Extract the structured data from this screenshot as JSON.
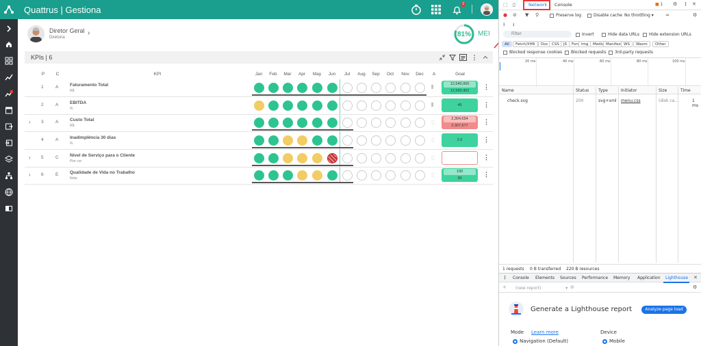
{
  "app": {
    "brand": "Quattrus | Gestiona",
    "notifications_badge": "2",
    "accent": "#1a9e8e"
  },
  "user": {
    "name": "Diretor Geral",
    "role": "Diretoria",
    "chevron": "›"
  },
  "gauge": {
    "percent_label": "81%",
    "percent_value": 81,
    "label": "MEI",
    "color": "#2fb88f"
  },
  "kpis": {
    "title": "KPIs | 6",
    "columns": {
      "p": "P",
      "c": "C",
      "kpi": "KPI",
      "months": [
        "Jan",
        "Feb",
        "Mar",
        "Apr",
        "May",
        "Jun",
        "Jul",
        "Aug",
        "Sep",
        "Oct",
        "Nov",
        "Dec"
      ],
      "a": "A",
      "goal": "Goal"
    },
    "rows": [
      {
        "p": "1",
        "c": "A",
        "name": "Faturamento Total",
        "unit": "R$",
        "expandable": false,
        "status": [
          "g",
          "g",
          "g",
          "g",
          "g",
          "g",
          "e",
          "e",
          "e",
          "e",
          "e",
          "e"
        ],
        "goal": [
          "12,540,000",
          "12,583,402"
        ],
        "goal_color": "green",
        "attach": true
      },
      {
        "p": "2",
        "c": "A",
        "name": "EBITDA",
        "unit": "%",
        "expandable": false,
        "status": [
          "y",
          "g",
          "g",
          "g",
          "g",
          "g",
          "e",
          "e",
          "e",
          "e",
          "e",
          "e"
        ],
        "goal": [
          "45"
        ],
        "goal_color": "green",
        "attach": true
      },
      {
        "p": "3",
        "c": "A",
        "name": "Custo Total",
        "unit": "R$",
        "expandable": true,
        "status": [
          "g",
          "g",
          "g",
          "g",
          "g",
          "g",
          "e",
          "e",
          "e",
          "e",
          "e",
          "e"
        ],
        "goal": [
          "2,304,654",
          "2,307,677"
        ],
        "goal_color": "red",
        "attach": false
      },
      {
        "p": "4",
        "c": "A",
        "name": "Inadimplência 30 dias",
        "unit": "%",
        "expandable": false,
        "status": [
          "g",
          "g",
          "y",
          "y",
          "g",
          "g",
          "e",
          "e",
          "e",
          "e",
          "e",
          "e"
        ],
        "goal": [
          "2.5"
        ],
        "goal_color": "green",
        "attach": false
      },
      {
        "p": "5",
        "c": "C",
        "name": "Nível de Serviço para o Cliente",
        "unit": "Pior cor",
        "expandable": true,
        "status": [
          "g",
          "g",
          "y",
          "y",
          "y",
          "r",
          "e",
          "e",
          "e",
          "e",
          "e",
          "e"
        ],
        "goal": [],
        "goal_color": "white",
        "attach": false
      },
      {
        "p": "6",
        "c": "E",
        "name": "Qualidade de Vida no Trabalho",
        "unit": "Nota",
        "expandable": true,
        "status": [
          "g",
          "g",
          "g",
          "y",
          "y",
          "g",
          "e",
          "e",
          "e",
          "e",
          "e",
          "e"
        ],
        "goal": [
          "100",
          "90"
        ],
        "goal_color": "green",
        "attach": false
      }
    ]
  },
  "devtools": {
    "tabs": [
      "Network",
      "Console"
    ],
    "issues_count": "1",
    "preserve_log": "Preserve log",
    "disable_cache": "Disable cache",
    "throttling": "No throttling",
    "filter_placeholder": "Filter",
    "invert": "Invert",
    "hide_data_urls": "Hide data URLs",
    "hide_extension_urls": "Hide extension URLs",
    "chips": [
      "All",
      "Fetch/XHR",
      "Doc",
      "CSS",
      "JS",
      "Font",
      "Img",
      "Media",
      "Manifest",
      "WS",
      "Wasm",
      "Other"
    ],
    "blocked_response_cookies": "Blocked response cookies",
    "blocked_requests": "Blocked requests",
    "third_party": "3rd-party requests",
    "timeline_ticks": [
      "20 ms",
      "40 ms",
      "60 ms",
      "80 ms",
      "100 ms"
    ],
    "table_headers": [
      "Name",
      "Status",
      "Type",
      "Initiator",
      "Size",
      "Time"
    ],
    "request": {
      "name": "check.svg",
      "status": "200",
      "type": "svg+xml",
      "initiator": "menu.css",
      "size": "(disk ca...",
      "time": "1 ms"
    },
    "summary": [
      "1 requests",
      "0 B transferred",
      "220 B resources"
    ],
    "bottom_tabs": [
      "Console",
      "Elements",
      "Sources",
      "Performance",
      "Memory",
      "Application",
      "Lighthouse"
    ],
    "report_placeholder": "(new report)",
    "lighthouse_title": "Generate a Lighthouse report",
    "analyze_button": "Analyze page load",
    "mode_label": "Mode",
    "learn_more": "Learn more",
    "device_label": "Device",
    "mode_option": "Navigation (Default)",
    "device_option": "Mobile"
  }
}
